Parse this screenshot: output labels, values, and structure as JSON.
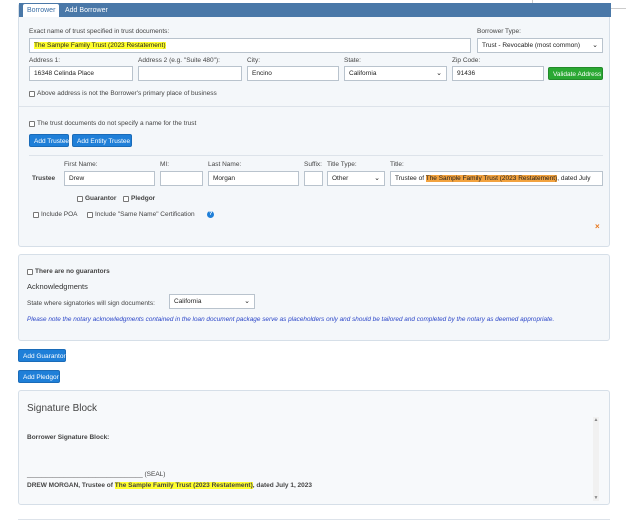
{
  "tabs": {
    "borrower": "Borrower",
    "add_borrower": "Add Borrower"
  },
  "trust": {
    "name_label": "Exact name of trust specified in trust documents:",
    "name_value": "The Sample Family Trust (2023 Restatement)",
    "borrower_type_label": "Borrower Type:",
    "borrower_type_value": "Trust - Revocable (most common)"
  },
  "address": {
    "addr1_label": "Address 1:",
    "addr1_value": "16348 Celinda Place",
    "addr2_label": "Address 2 (e.g. \"Suite 480\"):",
    "addr2_value": "",
    "city_label": "City:",
    "city_value": "Encino",
    "state_label": "State:",
    "state_value": "California",
    "zip_label": "Zip Code:",
    "zip_value": "91436",
    "validate_button": "Validate Address",
    "not_primary_label": "Above address is not the Borrower's primary place of business"
  },
  "trustee_section": {
    "no_name_label": "The trust documents do not specify a name for the trust",
    "add_trustee": "Add Trustee",
    "add_entity_trustee": "Add Entity Trustee"
  },
  "trustee": {
    "row_label": "Trustee",
    "first_label": "First Name:",
    "first_value": "Drew",
    "mi_label": "MI:",
    "mi_value": "",
    "last_label": "Last Name:",
    "last_value": "Morgan",
    "suffix_label": "Suffix:",
    "suffix_value": "",
    "title_type_label": "Title Type:",
    "title_type_value": "Other",
    "title_label": "Title:",
    "title_prefix": "Trustee of ",
    "title_highlight": "The Sample Family Trust (2023 Restatement)",
    "title_suffix": ", dated July",
    "guarantor": "Guarantor",
    "pledgor": "Pledgor",
    "include_poa": "Include POA",
    "include_same_name": "Include \"Same Name\" Certification",
    "help_glyph": "?",
    "remove_glyph": "×"
  },
  "guarantors": {
    "no_guarantors": "There are no guarantors",
    "ack_title": "Acknowledgments",
    "state_label": "State where signatories will sign documents:",
    "state_value": "California",
    "notary_note": "Please note the notary acknowledgments contained in the loan document package serve as placeholders only and should be tailored and completed by the notary as deemed appropriate."
  },
  "buttons": {
    "add_guarantor": "Add Guarantor",
    "add_pledgor": "Add Pledgor"
  },
  "signature": {
    "title": "Signature Block",
    "borrower_label": "Borrower Signature Block:",
    "seal_line": "________________________________ (SEAL)",
    "sig_prefix": "DREW MORGAN, Trustee of ",
    "sig_highlight": "The Sample Family Trust (2023 Restatement)",
    "sig_suffix": ", dated July 1, 2023"
  },
  "icons": {
    "chevron": "chevron-down-icon",
    "help": "help-circle-icon",
    "close": "close-x-icon"
  },
  "colors": {
    "tab_bar": "#4a78a8",
    "button_blue": "#1f7fd8",
    "button_green": "#2aa833",
    "highlight_yellow": "#ffff2e",
    "highlight_orange": "#f2a23e",
    "notary_text": "#2b46c8",
    "remove_x": "#e8761a"
  }
}
